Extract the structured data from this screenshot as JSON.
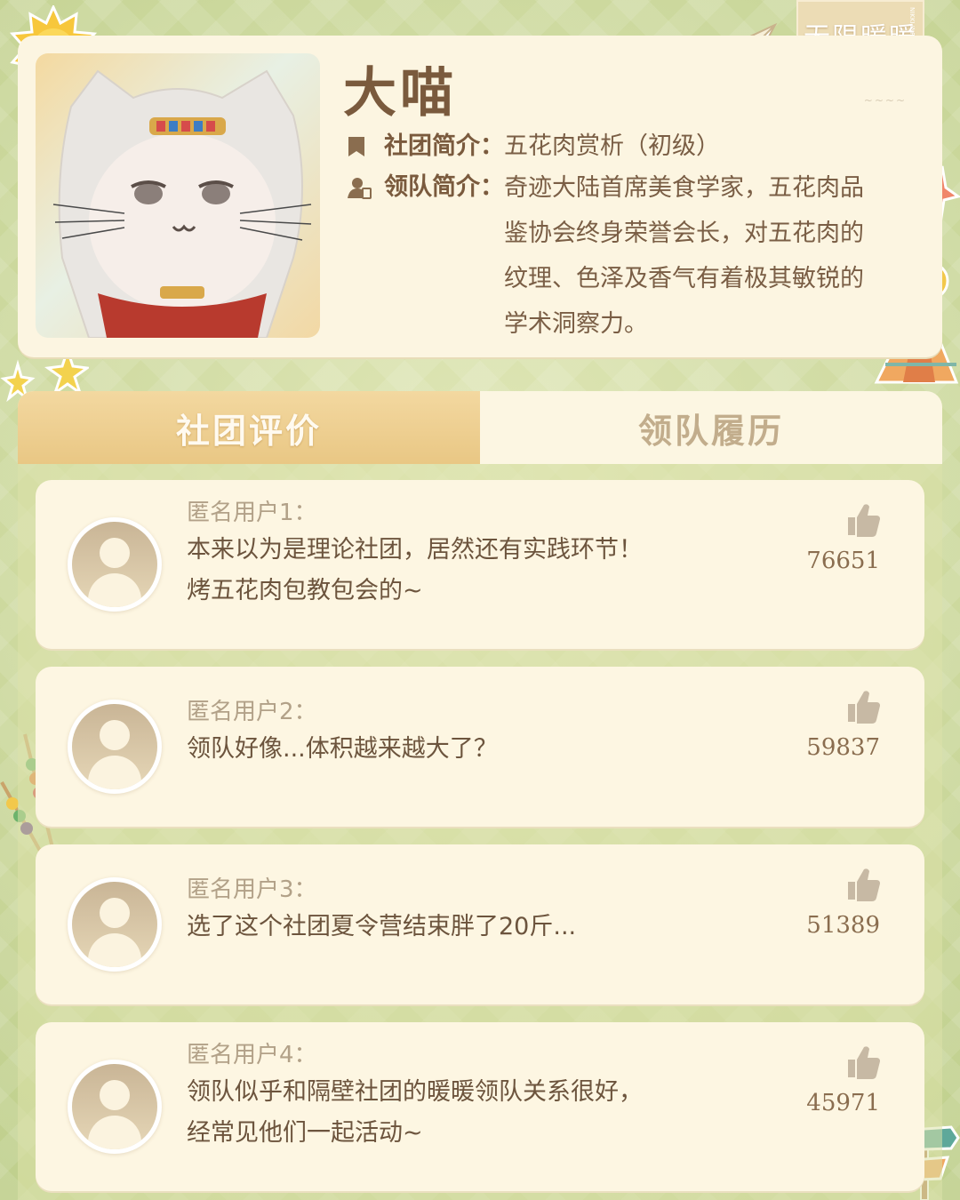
{
  "logo": {
    "text": "无限暖暖",
    "sub": "NIKKI INFINITY"
  },
  "leader": {
    "name": "大喵",
    "club_label": "社团简介：",
    "club_value": "五花肉赏析（初级）",
    "intro_label": "领队简介：",
    "intro_value": "奇迹大陆首席美食学家，五花肉品鉴协会终身荣誉会长，对五花肉的纹理、色泽及香气有着极其敏锐的学术洞察力。"
  },
  "tabs": [
    {
      "label": "社团评价",
      "active": true
    },
    {
      "label": "领队履历",
      "active": false
    }
  ],
  "reviews": [
    {
      "user": "匿名用户1：",
      "lines": [
        "本来以为是理论社团，居然还有实践环节！",
        "烤五花肉包教包会的~"
      ],
      "likes": "76651"
    },
    {
      "user": "匿名用户2：",
      "lines": [
        "领队好像...体积越来越大了？"
      ],
      "likes": "59837"
    },
    {
      "user": "匿名用户3：",
      "lines": [
        "选了这个社团夏令营结束胖了20斤..."
      ],
      "likes": "51389"
    },
    {
      "user": "匿名用户4：",
      "lines": [
        "领队似乎和隔壁社团的暖暖领队关系很好，",
        "经常见他们一起活动~"
      ],
      "likes": "45971"
    }
  ],
  "colors": {
    "accent_tab": "#e9c784",
    "card_bg": "#fdf6e2",
    "text_brown": "#7a5a3d",
    "bg_green": "#c9d79a"
  },
  "icons": {
    "club": "bookmark-icon",
    "leader": "person-badge-icon",
    "like": "thumbs-up-icon"
  }
}
